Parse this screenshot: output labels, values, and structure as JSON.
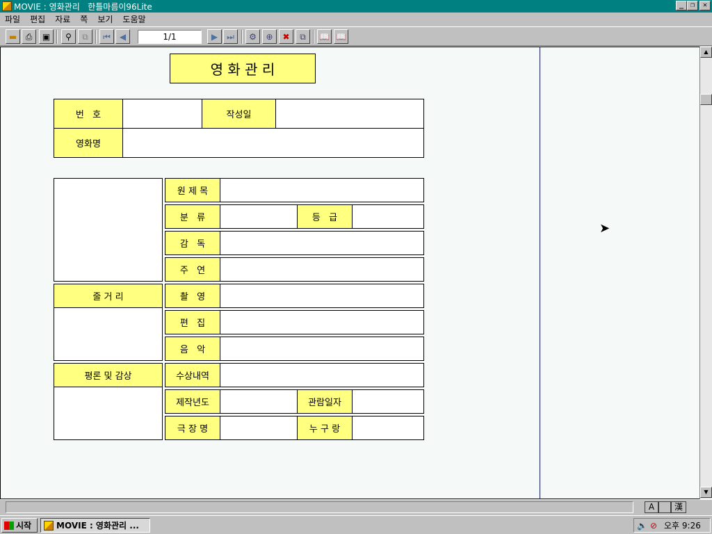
{
  "window": {
    "title": "MOVIE : 영화관리   한틀마름이96Lite",
    "minimize_label": "_",
    "restore_label": "❐",
    "close_label": "✕"
  },
  "menu": {
    "items": [
      "파일",
      "편집",
      "자료",
      "쪽",
      "보기",
      "도움말"
    ]
  },
  "toolbar": {
    "page_indicator": "1/1"
  },
  "form": {
    "title": "영 화 관 리",
    "number_label": "번   호",
    "date_label": "작성일",
    "movie_name_label": "영화명",
    "original_title_label": "원 제 목",
    "category_label": "분   류",
    "grade_label": "등   급",
    "director_label": "감   독",
    "cast_label": "주   연",
    "cinematography_label": "촬   영",
    "editing_label": "편   집",
    "music_label": "음   악",
    "awards_label": "수상내역",
    "year_label": "제작년도",
    "watch_date_label": "관람일자",
    "theater_label": "극 장 명",
    "audience_label": "누 구 랑",
    "plot_label": "줄 거 리",
    "review_label": "평론 및 감상"
  },
  "statusbar": {
    "ime_a": "A",
    "ime_b": "",
    "ime_c": "漢"
  },
  "taskbar": {
    "start_label": "시작",
    "task_label": "MOVIE : 영화관리 ...",
    "clock": "오후 9:26"
  },
  "icons": {
    "scroll_up": "▲",
    "scroll_down": "▼"
  }
}
